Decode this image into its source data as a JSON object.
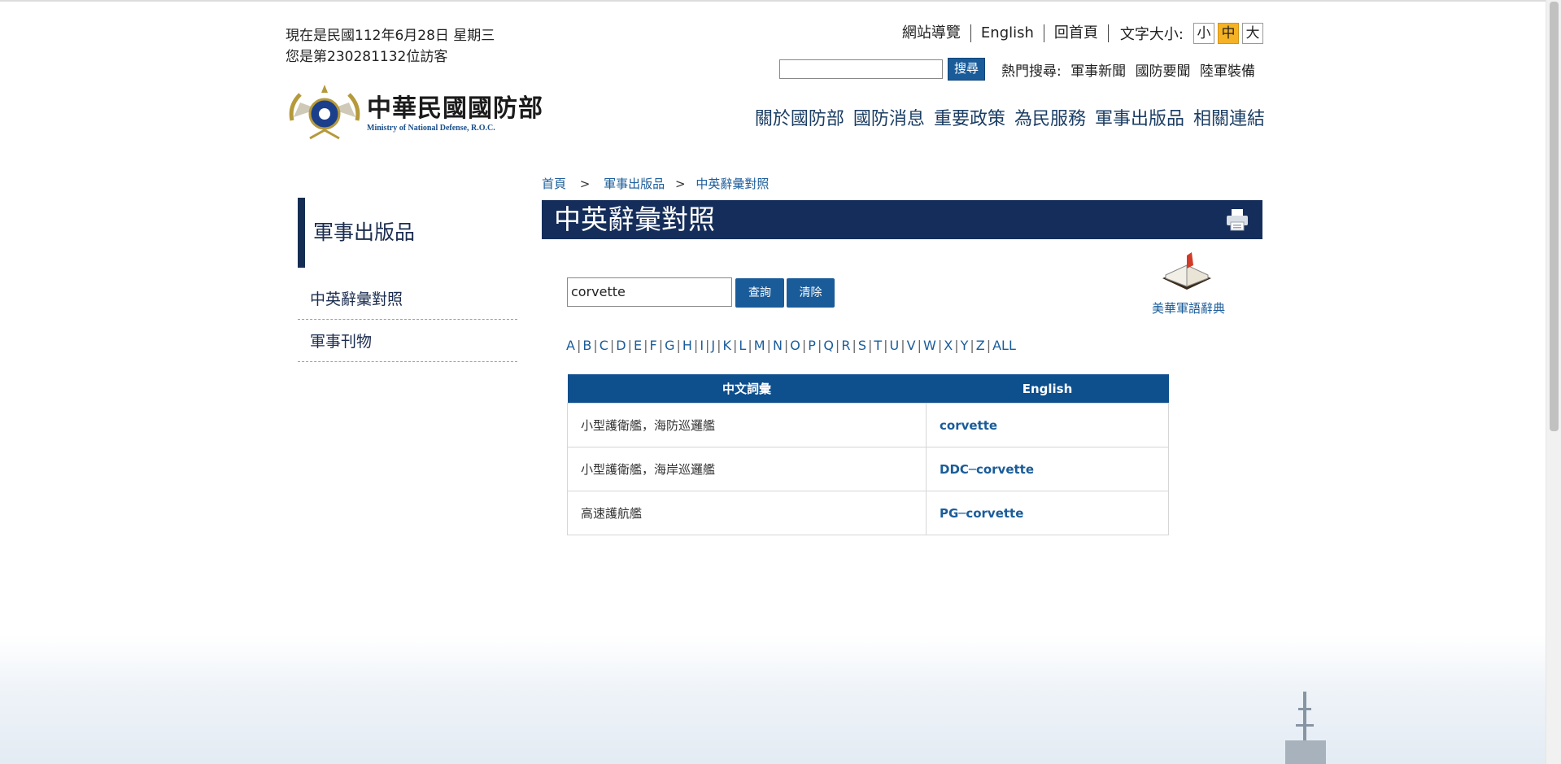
{
  "header": {
    "date_text": "現在是民國112年6月28日 星期三",
    "visitor_text": "您是第230281132位訪客",
    "top_links": [
      "網站導覽",
      "English",
      "回首頁"
    ],
    "font_size_label": "文字大小:",
    "font_sizes": [
      "小",
      "中",
      "大"
    ],
    "font_size_selected": "中",
    "search_button": "搜尋",
    "search_value": "",
    "hot_label": "熱門搜尋:",
    "hot_items": [
      "軍事新聞",
      "國防要聞",
      "陸軍裝備"
    ],
    "logo_cn": "中華民國國防部",
    "logo_en": "Ministry of National Defense, R.O.C.",
    "main_nav": [
      "關於國防部",
      "國防消息",
      "重要政策",
      "為民服務",
      "軍事出版品",
      "相關連結"
    ]
  },
  "breadcrumb": {
    "items": [
      "首頁",
      "軍事出版品",
      "中英辭彙對照"
    ],
    "separator": ">"
  },
  "sidebar": {
    "title": "軍事出版品",
    "items": [
      "中英辭彙對照",
      "軍事刊物"
    ]
  },
  "main": {
    "title": "中英辭彙對照",
    "query_value": "corvette",
    "query_button": "查詢",
    "clear_button": "清除",
    "dictionary_label": "美華軍語辭典",
    "letters": [
      "A",
      "B",
      "C",
      "D",
      "E",
      "F",
      "G",
      "H",
      "I",
      "J",
      "K",
      "L",
      "M",
      "N",
      "O",
      "P",
      "Q",
      "R",
      "S",
      "T",
      "U",
      "V",
      "W",
      "X",
      "Y",
      "Z",
      "ALL"
    ],
    "table": {
      "headers": [
        "中文詞彙",
        "English"
      ],
      "rows": [
        {
          "zh": "小型護衛艦，海防巡邏艦",
          "en": "corvette"
        },
        {
          "zh": "小型護衛艦，海岸巡邏艦",
          "en": "DDC─corvette"
        },
        {
          "zh": "高速護航艦",
          "en": "PG─corvette"
        }
      ]
    }
  },
  "colors": {
    "primary_dark": "#152d5a",
    "primary_blue": "#1a5c9a",
    "table_header": "#0e4f8d",
    "font_active": "#f5b224"
  }
}
